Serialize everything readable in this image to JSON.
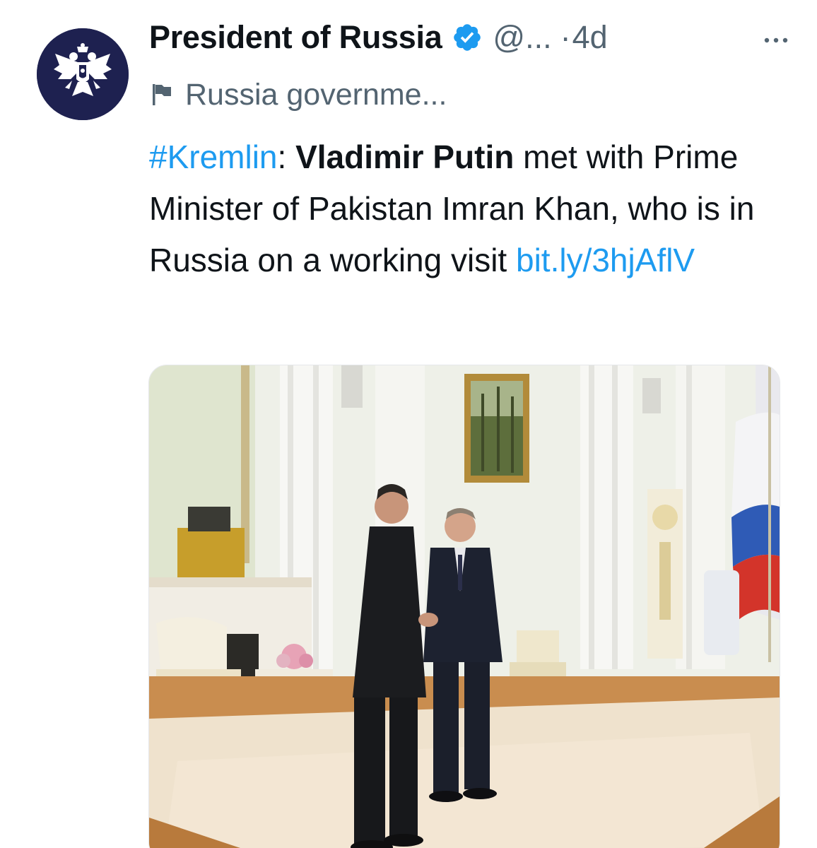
{
  "tweet": {
    "author": {
      "display_name": "President of Russia",
      "handle": "@...",
      "verified": true,
      "avatar_icon": "russian-coat-of-arms-icon"
    },
    "separator": "·",
    "timestamp": "4d",
    "more_icon": "more-horizontal-icon",
    "label": {
      "icon": "flag-icon",
      "text": "Russia governme..."
    },
    "text": {
      "hashtag": "#Kremlin",
      "colon": ": ",
      "name": "Vladimir Putin",
      "body": " met with Prime Minister of Pakistan Imran Khan, who is in Russia on a working visit ",
      "link": "bit.ly/3hjAflV"
    },
    "media": {
      "type": "photo"
    }
  },
  "colors": {
    "link": "#1d9bf0",
    "secondary_text": "#536471",
    "primary_text": "#0f1419",
    "verified_badge": "#1d9bf0",
    "avatar_bg": "#1e2150"
  }
}
